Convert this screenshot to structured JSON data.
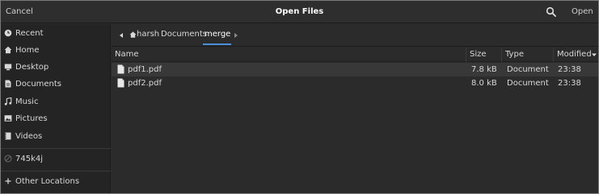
{
  "header": {
    "cancel_label": "Cancel",
    "title": "Open Files",
    "open_label": "Open",
    "search_icon": "search-icon"
  },
  "sidebar": {
    "items": [
      {
        "label": "Recent",
        "icon": "clock-icon"
      },
      {
        "label": "Home",
        "icon": "home-icon"
      },
      {
        "label": "Desktop",
        "icon": "desktop-icon"
      },
      {
        "label": "Documents",
        "icon": "document-icon"
      },
      {
        "label": "Music",
        "icon": "music-icon"
      },
      {
        "label": "Pictures",
        "icon": "picture-icon"
      },
      {
        "label": "Videos",
        "icon": "video-icon"
      }
    ],
    "device": {
      "label": "745k4j",
      "icon": "drive-icon"
    },
    "other": {
      "label": "Other Locations",
      "icon": "plus-icon"
    }
  },
  "pathbar": {
    "back_icon": "chevron-left-icon",
    "segments": [
      "harsh",
      "Documents",
      "merge"
    ],
    "forward_icon": "chevron-right-icon"
  },
  "columns": {
    "name": "Name",
    "size": "Size",
    "type": "Type",
    "modified": "Modified",
    "sort_icon": "sort-down-icon"
  },
  "files": [
    {
      "name": "pdf1.pdf",
      "size": "7.8 kB",
      "type": "Document",
      "modified": "23:38",
      "selected": true
    },
    {
      "name": "pdf2.pdf",
      "size": "8.0 kB",
      "type": "Document",
      "modified": "23:38",
      "selected": false
    }
  ],
  "colors": {
    "accent": "#4a90d9",
    "background": "#2b2b2b",
    "sidebar": "#242424",
    "selected_row": "#383838"
  }
}
